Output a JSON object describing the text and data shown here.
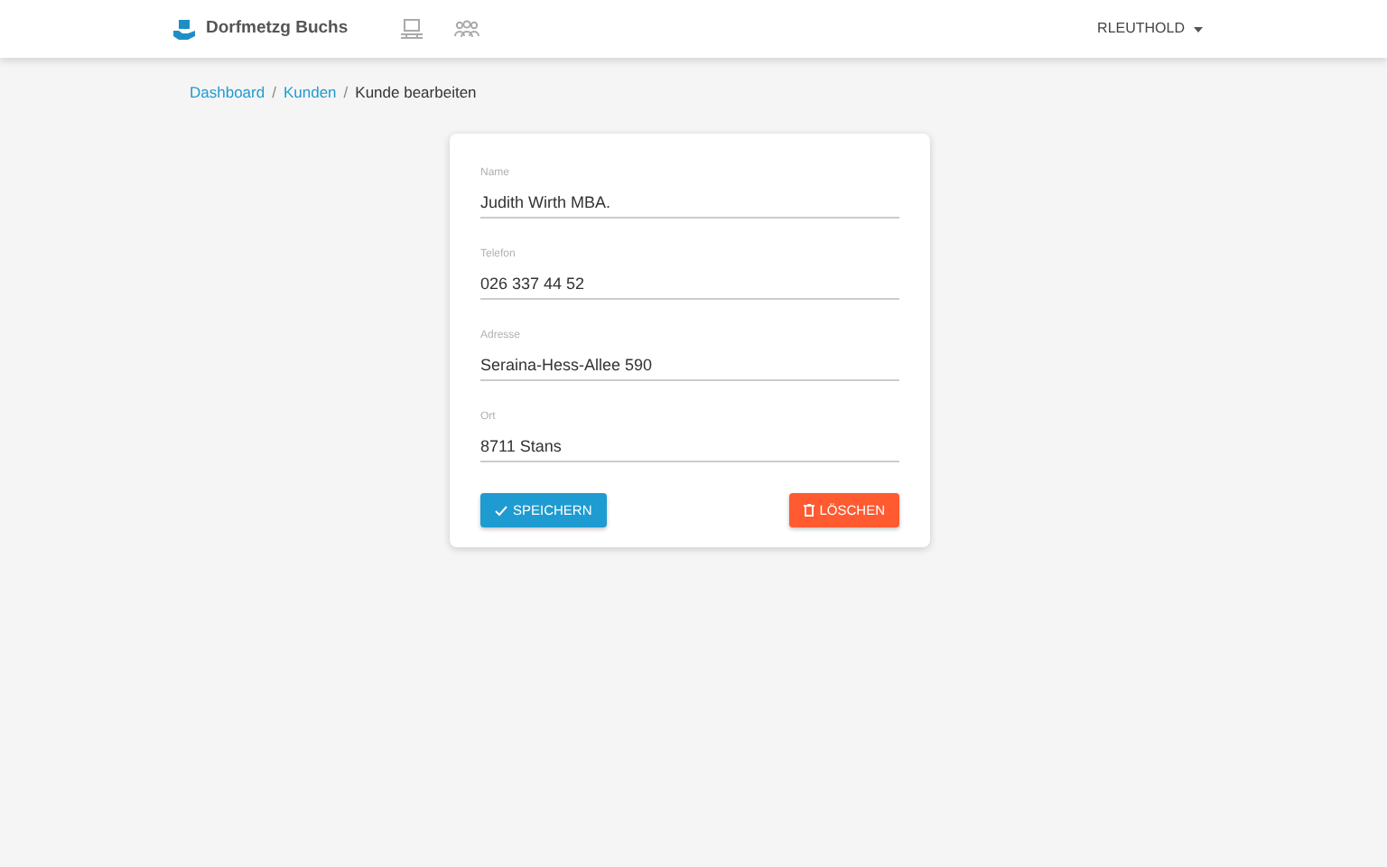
{
  "navbar": {
    "brand": "Dorfmetzg Buchs",
    "user_menu": "RLEUTHOLD"
  },
  "breadcrumb": [
    {
      "label": "Dashboard",
      "kind": "link"
    },
    {
      "label": "/",
      "kind": "separator"
    },
    {
      "label": "Kunden",
      "kind": "link"
    },
    {
      "label": "/",
      "kind": "separator"
    },
    {
      "label": "Kunde bearbeiten",
      "kind": "current"
    }
  ],
  "form": {
    "fields": [
      {
        "label": "Name",
        "value": "Judith Wirth MBA."
      },
      {
        "label": "Telefon",
        "value": "026 337 44 52"
      },
      {
        "label": "Adresse",
        "value": "Seraina-Hess-Allee 590"
      },
      {
        "label": "Ort",
        "value": "8711 Stans"
      }
    ],
    "buttons": [
      {
        "label": "SPEICHERN",
        "kind": "save"
      },
      {
        "label": "LÖSCHEN",
        "kind": "delete"
      }
    ]
  }
}
